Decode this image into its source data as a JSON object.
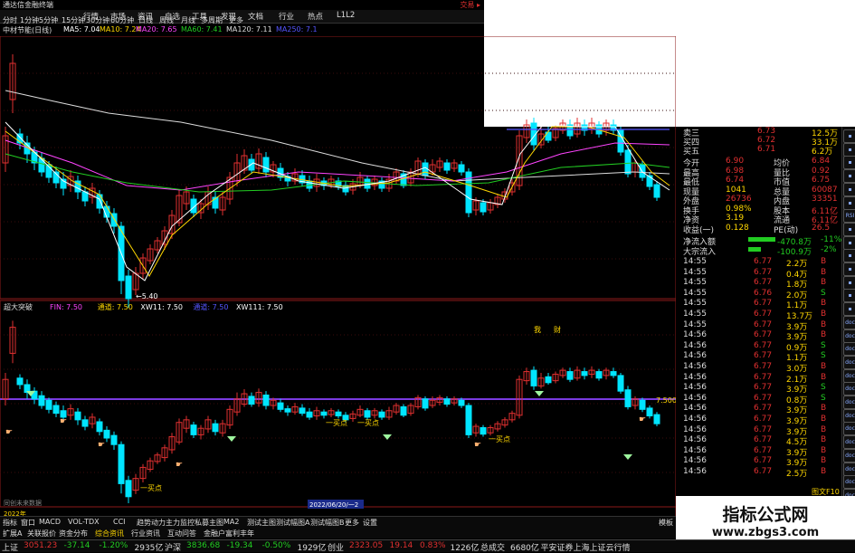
{
  "window": {
    "title": "通达信金融终端",
    "trade_label": "交易 ▸"
  },
  "menu": {
    "items": [
      "行情",
      "市场",
      "资讯",
      "自选",
      "工具",
      "发现",
      "文档",
      "行业",
      "热点",
      "L1L2"
    ]
  },
  "periods": {
    "items": [
      "分时",
      "1分钟",
      "5分钟",
      "15分钟",
      "30分钟",
      "60分钟",
      "日线",
      "周线",
      "月线",
      "多周期",
      "更多"
    ]
  },
  "ma_legend": {
    "stock_name": "中材节能(日线)",
    "items": [
      {
        "label": "MA5: 7.04",
        "color": "#ffffff"
      },
      {
        "label": "MA10: 7.24",
        "color": "#ffd700"
      },
      {
        "label": "MA20: 7.65",
        "color": "#ff44ff"
      },
      {
        "label": "MA60: 7.41",
        "color": "#22cc22"
      },
      {
        "label": "MA120: 7.11",
        "color": "#dddddd"
      },
      {
        "label": "MA250: 7.1",
        "color": "#5555ff"
      }
    ]
  },
  "main_chart": {
    "price_ticks": [
      "7.75",
      "7.50",
      "7.25",
      "7.00",
      "6.75",
      "6.50",
      "6.25",
      "6.00",
      "5.75",
      "5.50"
    ],
    "current_price_tag": "5.69",
    "low_label": "5.40",
    "markers": [
      "我",
      "财"
    ]
  },
  "sub_chart": {
    "title": "超大突破",
    "legend": [
      {
        "label": "FIN: 7.50",
        "color": "#ff44ff"
      },
      {
        "label": "通道: 7.50",
        "color": "#ffd700"
      },
      {
        "label": "XW11: 7.50",
        "color": "#ffffff"
      },
      {
        "label": "通道: 7.50",
        "color": "#5555ff"
      },
      {
        "label": "XW111: 7.50",
        "color": "#ffffff"
      }
    ],
    "price_ticks": [
      "9.00",
      "8.50",
      "8.00",
      "7.50",
      "7.00",
      "6.50",
      "6.00",
      "5.50"
    ],
    "line_label": "7.500",
    "buy_labels": [
      "一买点",
      "一买点",
      "一买点",
      "一买点"
    ],
    "footer_note": "同创未来数据",
    "date_tag": "2022/06/20/一2",
    "year_tag": "2022年"
  },
  "quote_panel": {
    "ask_rows": [
      {
        "label": "卖三",
        "price": "6.73",
        "vol": "12.5万"
      },
      {
        "label": "买四",
        "price": "6.72",
        "vol": "33.1万"
      },
      {
        "label": "买五",
        "price": "6.71",
        "vol": "6.2万"
      }
    ],
    "stats": [
      {
        "l1": "今开",
        "v1": "6.90",
        "l2": "均价",
        "v2": "6.84"
      },
      {
        "l1": "最高",
        "v1": "6.98",
        "l2": "量比",
        "v2": "0.92"
      },
      {
        "l1": "最低",
        "v1": "6.74",
        "l2": "市值",
        "v2": "6.75"
      },
      {
        "l1": "现量",
        "v1": "1041",
        "l2": "总量",
        "v2": "60087"
      },
      {
        "l1": "外盘",
        "v1": "26736",
        "l2": "内盘",
        "v2": "33351"
      },
      {
        "l1": "换手",
        "v1": "0.98%",
        "l2": "股本",
        "v2": "6.11亿"
      },
      {
        "l1": "净资",
        "v1": "3.19",
        "l2": "流通",
        "v2": "6.11亿"
      },
      {
        "l1": "收益(一)",
        "v1": "0.128",
        "l2": "PE(动)",
        "v2": "26.5"
      }
    ],
    "flows": [
      {
        "label": "净流入额",
        "value": "-470.8万",
        "pct": "-11%"
      },
      {
        "label": "大宗流入",
        "value": "-100.9万",
        "pct": "-2%"
      }
    ],
    "ticks": [
      {
        "t": "14:55",
        "p": "6.77",
        "v": "2.2万",
        "s": "B"
      },
      {
        "t": "14:55",
        "p": "6.77",
        "v": "0.4万",
        "s": "B"
      },
      {
        "t": "14:55",
        "p": "6.77",
        "v": "1.8万",
        "s": "B"
      },
      {
        "t": "14:55",
        "p": "6.76",
        "v": "2.0万",
        "s": "S"
      },
      {
        "t": "14:55",
        "p": "6.77",
        "v": "1.1万",
        "s": "B"
      },
      {
        "t": "14:55",
        "p": "6.77",
        "v": "13.7万",
        "s": "B"
      },
      {
        "t": "14:55",
        "p": "6.77",
        "v": "3.9万",
        "s": "B"
      },
      {
        "t": "14:56",
        "p": "6.77",
        "v": "3.9万",
        "s": "B"
      },
      {
        "t": "14:56",
        "p": "6.77",
        "v": "0.9万",
        "s": "S"
      },
      {
        "t": "14:56",
        "p": "6.77",
        "v": "1.1万",
        "s": "S"
      },
      {
        "t": "14:56",
        "p": "6.77",
        "v": "3.0万",
        "s": "B"
      },
      {
        "t": "14:56",
        "p": "6.77",
        "v": "2.1万",
        "s": "B"
      },
      {
        "t": "14:56",
        "p": "6.77",
        "v": "3.9万",
        "s": "S"
      },
      {
        "t": "14:56",
        "p": "6.77",
        "v": "0.8万",
        "s": "S"
      },
      {
        "t": "14:56",
        "p": "6.77",
        "v": "3.9万",
        "s": "B"
      },
      {
        "t": "14:56",
        "p": "6.77",
        "v": "3.9万",
        "s": "B"
      },
      {
        "t": "14:56",
        "p": "6.77",
        "v": "3.9万",
        "s": "B"
      },
      {
        "t": "14:56",
        "p": "6.77",
        "v": "4.5万",
        "s": "B"
      },
      {
        "t": "14:56",
        "p": "6.77",
        "v": "3.9万",
        "s": "B"
      },
      {
        "t": "14:56",
        "p": "6.77",
        "v": "3.9万",
        "s": "B"
      },
      {
        "t": "14:56",
        "p": "6.77",
        "v": "2.5万",
        "s": "B"
      }
    ],
    "footer": "图文F10"
  },
  "sidebar": {
    "icons": [
      "arrow-up",
      "arrow-down",
      "grid",
      "chart",
      "chart",
      "list",
      "RSI",
      "plus",
      "minus",
      "arrow-left",
      "arrow-right",
      "menu",
      "chart",
      "pencil",
      "doc",
      "doc",
      "doc",
      "doc",
      "doc",
      "doc",
      "doc",
      "doc",
      "doc",
      "doc",
      "doc",
      "doc",
      "doc",
      "doc",
      "doc",
      "doc"
    ]
  },
  "watermark": {
    "line1": "指标公式网",
    "line2": "www.zbgs3.com"
  },
  "tabs": {
    "items": [
      "指标",
      "窗口",
      "MACD",
      "VOL-TDX",
      "CCI",
      "趋势动力",
      "主力监控",
      "私募主图",
      "MA2",
      "测试主图",
      "测试幅图A",
      "测试幅图B",
      "更多",
      "设置"
    ],
    "left": "扩展A",
    "left2": "关联报价",
    "sub": [
      "资金分布",
      "综合资讯",
      "行业资讯",
      "互动问答",
      "金融户富利丰年"
    ],
    "right": "模板"
  },
  "statusbar": {
    "items": [
      {
        "text": "上证",
        "color": "#ddd"
      },
      {
        "text": "3051.23",
        "color": "#e03030"
      },
      {
        "text": "-37.14",
        "color": "#22cc22"
      },
      {
        "text": "-1.20%",
        "color": "#22cc22"
      },
      {
        "text": "2935亿",
        "color": "#ddd"
      },
      {
        "text": "沪深",
        "color": "#ddd"
      },
      {
        "text": "3836.68",
        "color": "#22cc22"
      },
      {
        "text": "-19.34",
        "color": "#22cc22"
      },
      {
        "text": "-0.50%",
        "color": "#22cc22"
      },
      {
        "text": "1929亿",
        "color": "#ddd"
      },
      {
        "text": "创业",
        "color": "#ddd"
      },
      {
        "text": "2323.05",
        "color": "#e03030"
      },
      {
        "text": "19.14",
        "color": "#e03030"
      },
      {
        "text": "0.83%",
        "color": "#e03030"
      },
      {
        "text": "1226亿",
        "color": "#ddd"
      },
      {
        "text": "总成交",
        "color": "#ddd"
      },
      {
        "text": "6680亿",
        "color": "#ddd"
      },
      {
        "text": "平安证券上海上证云行情",
        "color": "#ddd"
      }
    ]
  },
  "colors": {
    "up": "#e03030",
    "down": "#00e5ff",
    "bg": "#000000",
    "grid": "#8b1a1a",
    "accent": "#e03030",
    "band": "#7a3ae0"
  }
}
